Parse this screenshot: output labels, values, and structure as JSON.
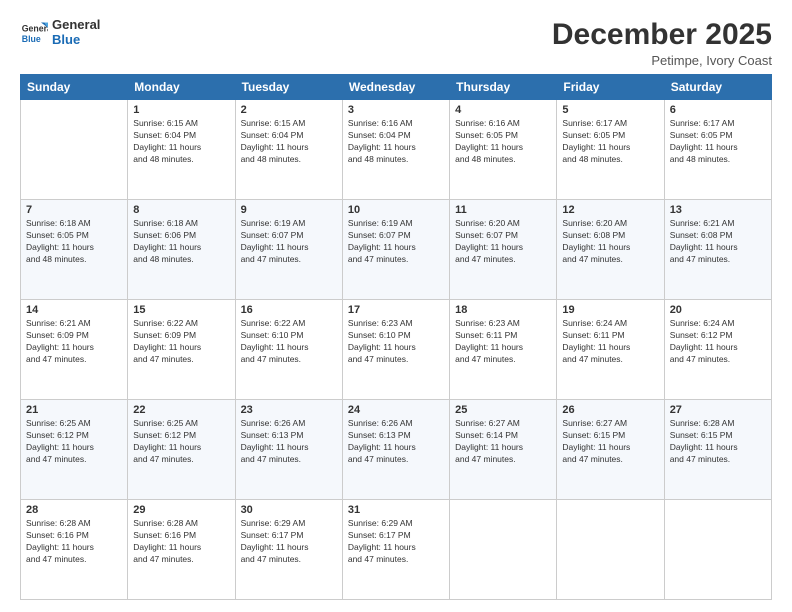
{
  "header": {
    "logo_line1": "General",
    "logo_line2": "Blue",
    "month": "December 2025",
    "location": "Petimpe, Ivory Coast"
  },
  "days_of_week": [
    "Sunday",
    "Monday",
    "Tuesday",
    "Wednesday",
    "Thursday",
    "Friday",
    "Saturday"
  ],
  "weeks": [
    [
      {
        "day": "",
        "info": ""
      },
      {
        "day": "1",
        "info": "Sunrise: 6:15 AM\nSunset: 6:04 PM\nDaylight: 11 hours\nand 48 minutes."
      },
      {
        "day": "2",
        "info": "Sunrise: 6:15 AM\nSunset: 6:04 PM\nDaylight: 11 hours\nand 48 minutes."
      },
      {
        "day": "3",
        "info": "Sunrise: 6:16 AM\nSunset: 6:04 PM\nDaylight: 11 hours\nand 48 minutes."
      },
      {
        "day": "4",
        "info": "Sunrise: 6:16 AM\nSunset: 6:05 PM\nDaylight: 11 hours\nand 48 minutes."
      },
      {
        "day": "5",
        "info": "Sunrise: 6:17 AM\nSunset: 6:05 PM\nDaylight: 11 hours\nand 48 minutes."
      },
      {
        "day": "6",
        "info": "Sunrise: 6:17 AM\nSunset: 6:05 PM\nDaylight: 11 hours\nand 48 minutes."
      }
    ],
    [
      {
        "day": "7",
        "info": "Sunrise: 6:18 AM\nSunset: 6:05 PM\nDaylight: 11 hours\nand 48 minutes."
      },
      {
        "day": "8",
        "info": "Sunrise: 6:18 AM\nSunset: 6:06 PM\nDaylight: 11 hours\nand 48 minutes."
      },
      {
        "day": "9",
        "info": "Sunrise: 6:19 AM\nSunset: 6:07 PM\nDaylight: 11 hours\nand 47 minutes."
      },
      {
        "day": "10",
        "info": "Sunrise: 6:19 AM\nSunset: 6:07 PM\nDaylight: 11 hours\nand 47 minutes."
      },
      {
        "day": "11",
        "info": "Sunrise: 6:20 AM\nSunset: 6:07 PM\nDaylight: 11 hours\nand 47 minutes."
      },
      {
        "day": "12",
        "info": "Sunrise: 6:20 AM\nSunset: 6:08 PM\nDaylight: 11 hours\nand 47 minutes."
      },
      {
        "day": "13",
        "info": "Sunrise: 6:21 AM\nSunset: 6:08 PM\nDaylight: 11 hours\nand 47 minutes."
      }
    ],
    [
      {
        "day": "14",
        "info": "Sunrise: 6:21 AM\nSunset: 6:09 PM\nDaylight: 11 hours\nand 47 minutes."
      },
      {
        "day": "15",
        "info": "Sunrise: 6:22 AM\nSunset: 6:09 PM\nDaylight: 11 hours\nand 47 minutes."
      },
      {
        "day": "16",
        "info": "Sunrise: 6:22 AM\nSunset: 6:10 PM\nDaylight: 11 hours\nand 47 minutes."
      },
      {
        "day": "17",
        "info": "Sunrise: 6:23 AM\nSunset: 6:10 PM\nDaylight: 11 hours\nand 47 minutes."
      },
      {
        "day": "18",
        "info": "Sunrise: 6:23 AM\nSunset: 6:11 PM\nDaylight: 11 hours\nand 47 minutes."
      },
      {
        "day": "19",
        "info": "Sunrise: 6:24 AM\nSunset: 6:11 PM\nDaylight: 11 hours\nand 47 minutes."
      },
      {
        "day": "20",
        "info": "Sunrise: 6:24 AM\nSunset: 6:12 PM\nDaylight: 11 hours\nand 47 minutes."
      }
    ],
    [
      {
        "day": "21",
        "info": "Sunrise: 6:25 AM\nSunset: 6:12 PM\nDaylight: 11 hours\nand 47 minutes."
      },
      {
        "day": "22",
        "info": "Sunrise: 6:25 AM\nSunset: 6:12 PM\nDaylight: 11 hours\nand 47 minutes."
      },
      {
        "day": "23",
        "info": "Sunrise: 6:26 AM\nSunset: 6:13 PM\nDaylight: 11 hours\nand 47 minutes."
      },
      {
        "day": "24",
        "info": "Sunrise: 6:26 AM\nSunset: 6:13 PM\nDaylight: 11 hours\nand 47 minutes."
      },
      {
        "day": "25",
        "info": "Sunrise: 6:27 AM\nSunset: 6:14 PM\nDaylight: 11 hours\nand 47 minutes."
      },
      {
        "day": "26",
        "info": "Sunrise: 6:27 AM\nSunset: 6:15 PM\nDaylight: 11 hours\nand 47 minutes."
      },
      {
        "day": "27",
        "info": "Sunrise: 6:28 AM\nSunset: 6:15 PM\nDaylight: 11 hours\nand 47 minutes."
      }
    ],
    [
      {
        "day": "28",
        "info": "Sunrise: 6:28 AM\nSunset: 6:16 PM\nDaylight: 11 hours\nand 47 minutes."
      },
      {
        "day": "29",
        "info": "Sunrise: 6:28 AM\nSunset: 6:16 PM\nDaylight: 11 hours\nand 47 minutes."
      },
      {
        "day": "30",
        "info": "Sunrise: 6:29 AM\nSunset: 6:17 PM\nDaylight: 11 hours\nand 47 minutes."
      },
      {
        "day": "31",
        "info": "Sunrise: 6:29 AM\nSunset: 6:17 PM\nDaylight: 11 hours\nand 47 minutes."
      },
      {
        "day": "",
        "info": ""
      },
      {
        "day": "",
        "info": ""
      },
      {
        "day": "",
        "info": ""
      }
    ]
  ]
}
